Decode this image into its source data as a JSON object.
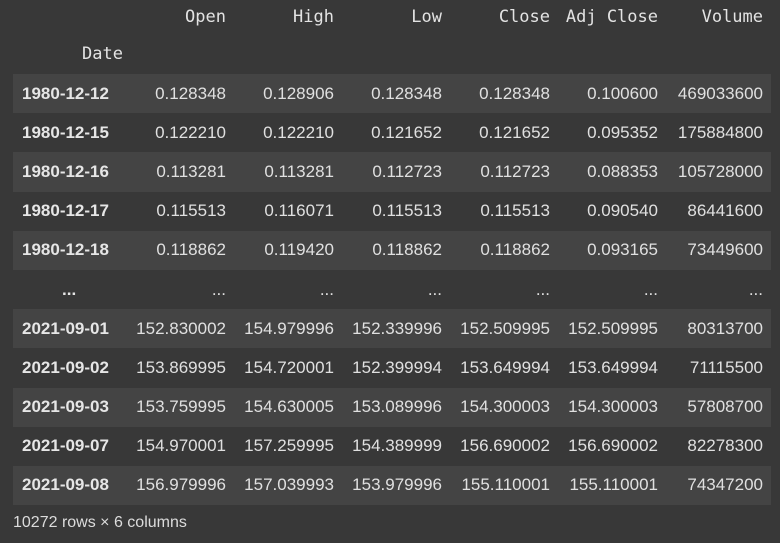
{
  "dataframe": {
    "index_name": "Date",
    "columns": [
      "Open",
      "High",
      "Low",
      "Close",
      "Adj Close",
      "Volume"
    ],
    "rows": [
      {
        "index": "1980-12-12",
        "cells": [
          "0.128348",
          "0.128906",
          "0.128348",
          "0.128348",
          "0.100600",
          "469033600"
        ]
      },
      {
        "index": "1980-12-15",
        "cells": [
          "0.122210",
          "0.122210",
          "0.121652",
          "0.121652",
          "0.095352",
          "175884800"
        ]
      },
      {
        "index": "1980-12-16",
        "cells": [
          "0.113281",
          "0.113281",
          "0.112723",
          "0.112723",
          "0.088353",
          "105728000"
        ]
      },
      {
        "index": "1980-12-17",
        "cells": [
          "0.115513",
          "0.116071",
          "0.115513",
          "0.115513",
          "0.090540",
          "86441600"
        ]
      },
      {
        "index": "1980-12-18",
        "cells": [
          "0.118862",
          "0.119420",
          "0.118862",
          "0.118862",
          "0.093165",
          "73449600"
        ]
      },
      {
        "index": "...",
        "cells": [
          "...",
          "...",
          "...",
          "...",
          "...",
          "..."
        ]
      },
      {
        "index": "2021-09-01",
        "cells": [
          "152.830002",
          "154.979996",
          "152.339996",
          "152.509995",
          "152.509995",
          "80313700"
        ]
      },
      {
        "index": "2021-09-02",
        "cells": [
          "153.869995",
          "154.720001",
          "152.399994",
          "153.649994",
          "153.649994",
          "71115500"
        ]
      },
      {
        "index": "2021-09-03",
        "cells": [
          "153.759995",
          "154.630005",
          "153.089996",
          "154.300003",
          "154.300003",
          "57808700"
        ]
      },
      {
        "index": "2021-09-07",
        "cells": [
          "154.970001",
          "157.259995",
          "154.389999",
          "156.690002",
          "156.690002",
          "82278300"
        ]
      },
      {
        "index": "2021-09-08",
        "cells": [
          "156.979996",
          "157.039993",
          "153.979996",
          "155.110001",
          "155.110001",
          "74347200"
        ]
      }
    ],
    "shape_text": "10272 rows × 6 columns"
  }
}
